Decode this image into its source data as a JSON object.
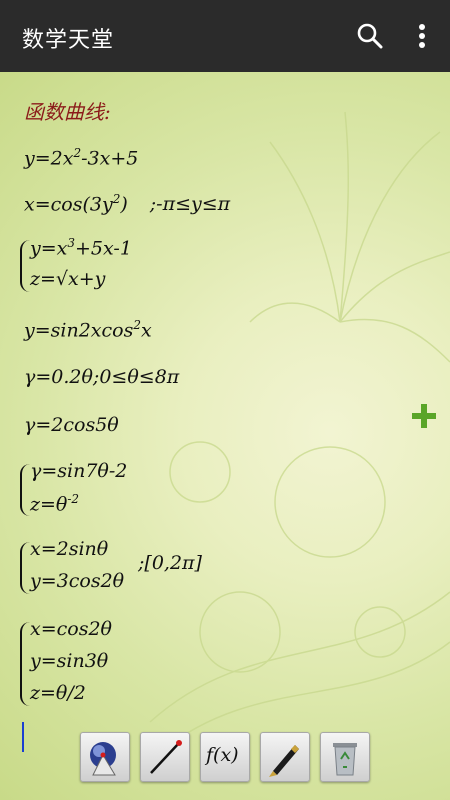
{
  "app": {
    "title": "数学天堂"
  },
  "content": {
    "heading": "函数曲线:",
    "formulas": {
      "f1_base": "y=2x",
      "f1_sup": "2",
      "f1_rest": "-3x+5",
      "f2_base": "x=cos(3y",
      "f2_sup": "2",
      "f2_rest": ")",
      "f2_range": ";-π≤y≤π",
      "f3_line1_base": "y=x",
      "f3_line1_sup": "3",
      "f3_line1_rest": "+5x-1",
      "f3_line2": "z=√x+y",
      "f4_base": "y=sin2xcos",
      "f4_sup": "2",
      "f4_rest": "x",
      "f5": "γ=0.2θ;0≤θ≤8π",
      "f6": "γ=2cos5θ",
      "f7_line1": "γ=sin7θ-2",
      "f7_line2_base": "z=θ",
      "f7_line2_sup": "-2",
      "f8_line1": "x=2sinθ",
      "f8_line2": "y=3cos2θ",
      "f8_range": ";[0,2π]",
      "f9_line1": "x=cos2θ",
      "f9_line2": "y=sin3θ",
      "f9_line3": "z=θ/2"
    }
  },
  "icons": {
    "search": "search-icon",
    "more": "more-vert-icon",
    "add": "add-icon",
    "tools": [
      "3d-graph-icon",
      "line-segment-icon",
      "function-icon",
      "pen-icon",
      "recycle-bin-icon"
    ]
  },
  "toolbar": {
    "function_label": "f(x)"
  },
  "colors": {
    "appbar": "#2b2b2b",
    "heading": "#8b1a1a",
    "add": "#5aa528",
    "cursor": "#1a3fd1"
  }
}
